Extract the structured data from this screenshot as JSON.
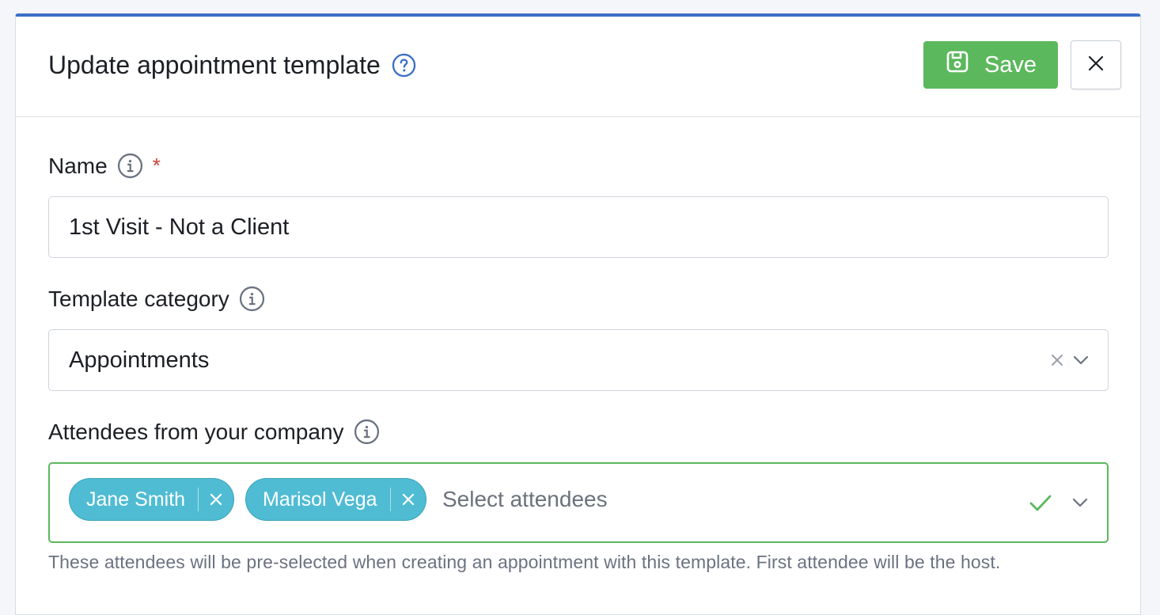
{
  "header": {
    "title": "Update appointment template",
    "help_icon": "question-circle-icon",
    "save_label": "Save",
    "save_icon": "floppy-disk-icon",
    "close_icon": "close-icon"
  },
  "fields": {
    "name": {
      "label": "Name",
      "required_mark": "*",
      "value": "1st Visit - Not a Client",
      "info_icon": "info-icon"
    },
    "template_category": {
      "label": "Template category",
      "value": "Appointments",
      "info_icon": "info-icon"
    },
    "attendees": {
      "label": "Attendees from your company",
      "info_icon": "info-icon",
      "selected": [
        {
          "name": "Jane Smith"
        },
        {
          "name": "Marisol Vega"
        }
      ],
      "placeholder": "Select attendees",
      "helper_text": "These attendees will be pre-selected when creating an appointment with this template. First attendee will be the host."
    }
  },
  "colors": {
    "accent_top_border": "#3a6fc4",
    "save_button": "#5cb85c",
    "tag_background": "#4fbcd3",
    "valid_border": "#5cb85c",
    "required_star": "#d0413a"
  }
}
